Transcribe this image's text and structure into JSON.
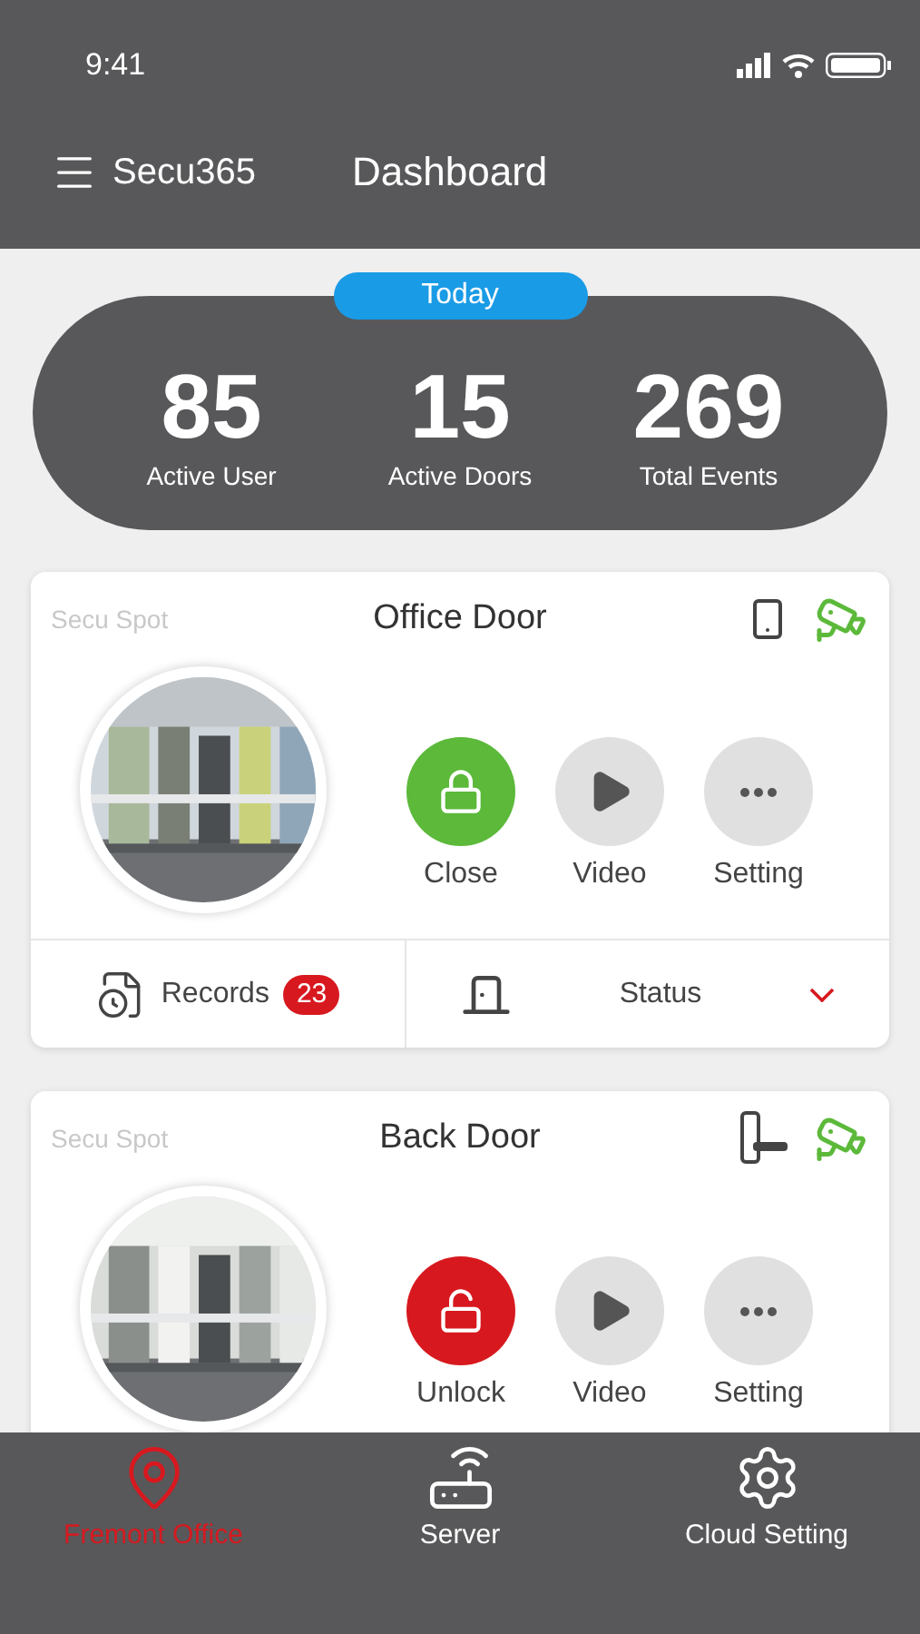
{
  "status_bar": {
    "time": "9:41"
  },
  "header": {
    "app_name": "Secu365",
    "title": "Dashboard"
  },
  "summary": {
    "badge": "Today",
    "stats": [
      {
        "value": "85",
        "label": "Active User"
      },
      {
        "value": "15",
        "label": "Active Doors"
      },
      {
        "value": "269",
        "label": "Total Events"
      }
    ]
  },
  "doors": [
    {
      "spot": "Secu Spot",
      "name": "Office Door",
      "device": {
        "kind": "reader"
      },
      "actions": [
        {
          "kind": "close",
          "label": "Close"
        },
        {
          "kind": "video",
          "label": "Video"
        },
        {
          "kind": "setting",
          "label": "Setting"
        }
      ],
      "footer": {
        "records": "Records",
        "records_count": "23",
        "status": "Status"
      }
    },
    {
      "spot": "Secu Spot",
      "name": "Back Door",
      "device": {
        "kind": "handle"
      },
      "actions": [
        {
          "kind": "unlock",
          "label": "Unlock"
        },
        {
          "kind": "video",
          "label": "Video"
        },
        {
          "kind": "setting",
          "label": "Setting"
        }
      ]
    }
  ],
  "tab_bar": [
    {
      "kind": "location",
      "label": "Fremont Office",
      "selected": true
    },
    {
      "kind": "server",
      "label": "Server",
      "selected": false
    },
    {
      "kind": "settings",
      "label": "Cloud Setting",
      "selected": false
    }
  ]
}
